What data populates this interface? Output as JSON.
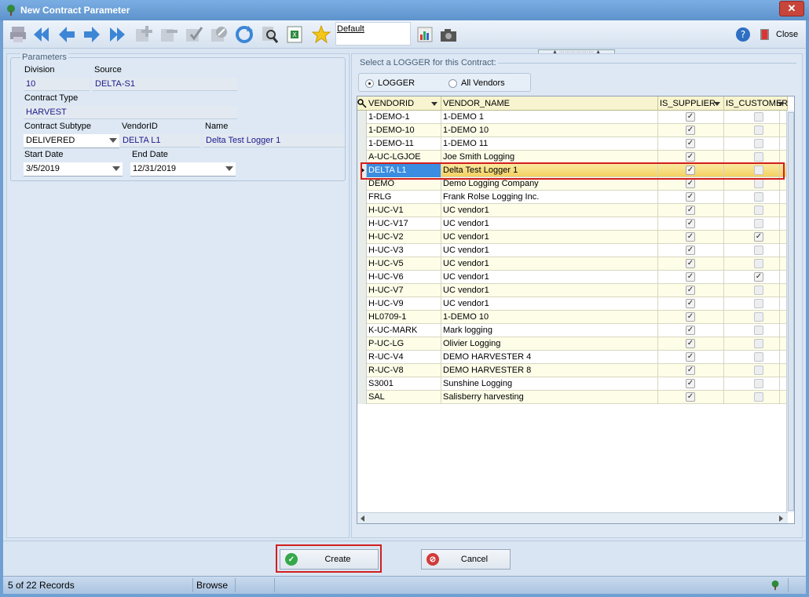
{
  "window": {
    "title": "New Contract Parameter",
    "close_glyph": "✕"
  },
  "toolbar": {
    "layout_label": "Default",
    "close_label": "Close",
    "icons": [
      "print-icon",
      "first-record-icon",
      "previous-record-icon",
      "next-record-icon",
      "last-record-icon",
      "add-record-icon",
      "delete-record-icon",
      "post-edit-icon",
      "cancel-edit-icon",
      "refresh-icon",
      "search-icon",
      "excel-export-icon",
      "favorite-star-icon",
      "chart-icon",
      "camera-icon",
      "help-icon"
    ]
  },
  "parameters": {
    "legend": "Parameters",
    "division_label": "Division",
    "division_value": "10",
    "source_label": "Source",
    "source_value": "DELTA-S1",
    "contract_type_label": "Contract Type",
    "contract_type_value": "HARVEST",
    "contract_subtype_label": "Contract Subtype",
    "contract_subtype_value": "DELIVERED",
    "vendorid_label": "VendorID",
    "vendorid_value": "DELTA L1",
    "name_label": "Name",
    "name_value": "Delta Test Logger 1",
    "start_date_label": "Start Date",
    "start_date_value": "3/5/2019",
    "end_date_label": "End Date",
    "end_date_value": "12/31/2019"
  },
  "logger": {
    "legend": "Select a LOGGER for this Contract:",
    "radio_logger": "LOGGER",
    "radio_all_vendors": "All Vendors",
    "selected_radio": "LOGGER"
  },
  "grid": {
    "columns": [
      "VENDORID",
      "VENDOR_NAME",
      "IS_SUPPLIER",
      "IS_CUSTOMER"
    ],
    "selected_index": 4,
    "rows": [
      {
        "vendorid": "1-DEMO-1",
        "vendor_name": "1-DEMO 1",
        "is_supplier": true,
        "is_customer": false
      },
      {
        "vendorid": "1-DEMO-10",
        "vendor_name": "1-DEMO 10",
        "is_supplier": true,
        "is_customer": false
      },
      {
        "vendorid": "1-DEMO-11",
        "vendor_name": "1-DEMO 11",
        "is_supplier": true,
        "is_customer": false
      },
      {
        "vendorid": "A-UC-LGJOE",
        "vendor_name": "Joe Smith Logging",
        "is_supplier": true,
        "is_customer": false
      },
      {
        "vendorid": "DELTA L1",
        "vendor_name": "Delta Test Logger 1",
        "is_supplier": true,
        "is_customer": false
      },
      {
        "vendorid": "DEMO",
        "vendor_name": "Demo Logging Company",
        "is_supplier": true,
        "is_customer": false
      },
      {
        "vendorid": "FRLG",
        "vendor_name": "Frank Rolse Logging Inc.",
        "is_supplier": true,
        "is_customer": false
      },
      {
        "vendorid": "H-UC-V1",
        "vendor_name": "UC vendor1",
        "is_supplier": true,
        "is_customer": false
      },
      {
        "vendorid": "H-UC-V17",
        "vendor_name": "UC vendor1",
        "is_supplier": true,
        "is_customer": false
      },
      {
        "vendorid": "H-UC-V2",
        "vendor_name": "UC vendor1",
        "is_supplier": true,
        "is_customer": true
      },
      {
        "vendorid": "H-UC-V3",
        "vendor_name": "UC vendor1",
        "is_supplier": true,
        "is_customer": false
      },
      {
        "vendorid": "H-UC-V5",
        "vendor_name": "UC vendor1",
        "is_supplier": true,
        "is_customer": false
      },
      {
        "vendorid": "H-UC-V6",
        "vendor_name": "UC vendor1",
        "is_supplier": true,
        "is_customer": true
      },
      {
        "vendorid": "H-UC-V7",
        "vendor_name": "UC vendor1",
        "is_supplier": true,
        "is_customer": false
      },
      {
        "vendorid": "H-UC-V9",
        "vendor_name": "UC vendor1",
        "is_supplier": true,
        "is_customer": false
      },
      {
        "vendorid": "HL0709-1",
        "vendor_name": "1-DEMO 10",
        "is_supplier": true,
        "is_customer": false
      },
      {
        "vendorid": "K-UC-MARK",
        "vendor_name": "Mark logging",
        "is_supplier": true,
        "is_customer": false
      },
      {
        "vendorid": "P-UC-LG",
        "vendor_name": "Olivier Logging",
        "is_supplier": true,
        "is_customer": false
      },
      {
        "vendorid": "R-UC-V4",
        "vendor_name": "DEMO HARVESTER 4",
        "is_supplier": true,
        "is_customer": false
      },
      {
        "vendorid": "R-UC-V8",
        "vendor_name": "DEMO HARVESTER 8",
        "is_supplier": true,
        "is_customer": false
      },
      {
        "vendorid": "S3001",
        "vendor_name": "Sunshine Logging",
        "is_supplier": true,
        "is_customer": false
      },
      {
        "vendorid": "SAL",
        "vendor_name": "Salisberry harvesting",
        "is_supplier": true,
        "is_customer": false
      }
    ]
  },
  "actions": {
    "create_label": "Create",
    "cancel_label": "Cancel"
  },
  "status": {
    "records": "5 of 22 Records",
    "mode": "Browse"
  },
  "colors": {
    "accent": "#5e92cb",
    "selection_row": "#f3d263",
    "selection_cell": "#3a8de0",
    "highlight_box": "#d21f1f"
  }
}
